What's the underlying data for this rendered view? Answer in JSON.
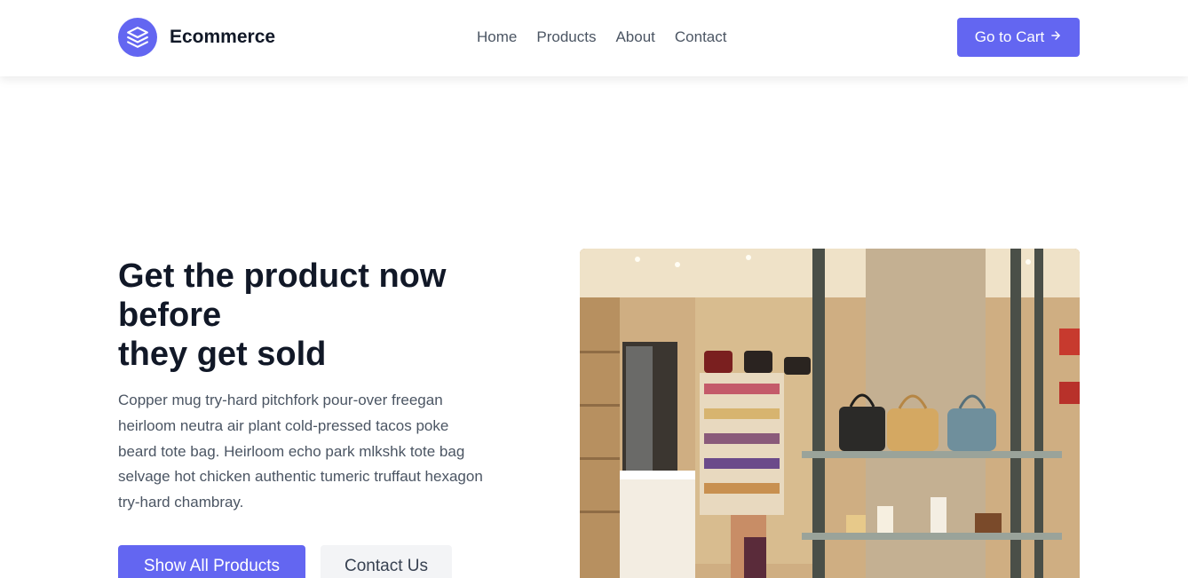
{
  "header": {
    "brand": {
      "name": "Ecommerce",
      "logo_icon": "layers-icon"
    },
    "nav": [
      {
        "label": "Home"
      },
      {
        "label": "Products"
      },
      {
        "label": "About"
      },
      {
        "label": "Contact"
      }
    ],
    "cart_button": {
      "label": "Go to Cart",
      "icon": "arrow-right-icon"
    }
  },
  "hero": {
    "title_lines": [
      "Get the product now before",
      "they get sold"
    ],
    "description": "Copper mug try-hard pitchfork pour-over freegan heirloom neutra air plant cold-pressed tacos poke beard tote bag. Heirloom echo park mlkshk tote bag selvage hot chicken authentic tumeric truffaut hexagon try-hard chambray.",
    "primary_button": "Show All Products",
    "secondary_button": "Contact Us"
  },
  "colors": {
    "accent": "#6366f1",
    "heading": "#111827",
    "body_text": "#4b5563",
    "secondary_button_bg": "#f3f4f6"
  }
}
